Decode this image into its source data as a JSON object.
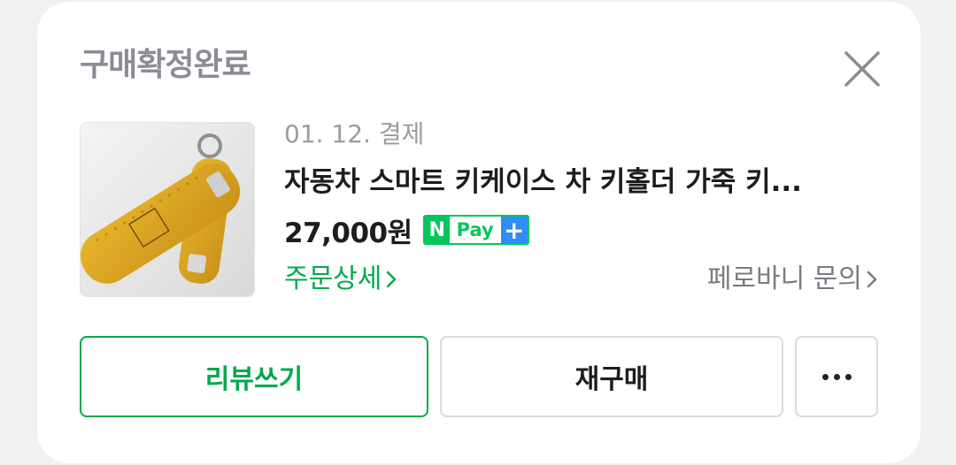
{
  "header": {
    "status": "구매확정완료",
    "close_icon": "close-icon"
  },
  "product": {
    "image_icon": "product-thumbnail-key-case",
    "date": "01. 12. 결제",
    "title": "자동차 스마트 키케이스 차 키홀더 가죽 키...",
    "price": "27,000원",
    "npay": {
      "n": "N",
      "label": "Pay",
      "plus": "+"
    }
  },
  "links": {
    "order_detail": "주문상세",
    "inquiry": "페로바니 문의"
  },
  "actions": {
    "review": "리뷰쓰기",
    "rebuy": "재구매",
    "more_icon": "more-dots-icon"
  },
  "colors": {
    "accent_green": "#03a94e",
    "npay_green": "#03c75a",
    "npay_blue": "#2f8ef5",
    "status_gray": "#8a8d94"
  }
}
